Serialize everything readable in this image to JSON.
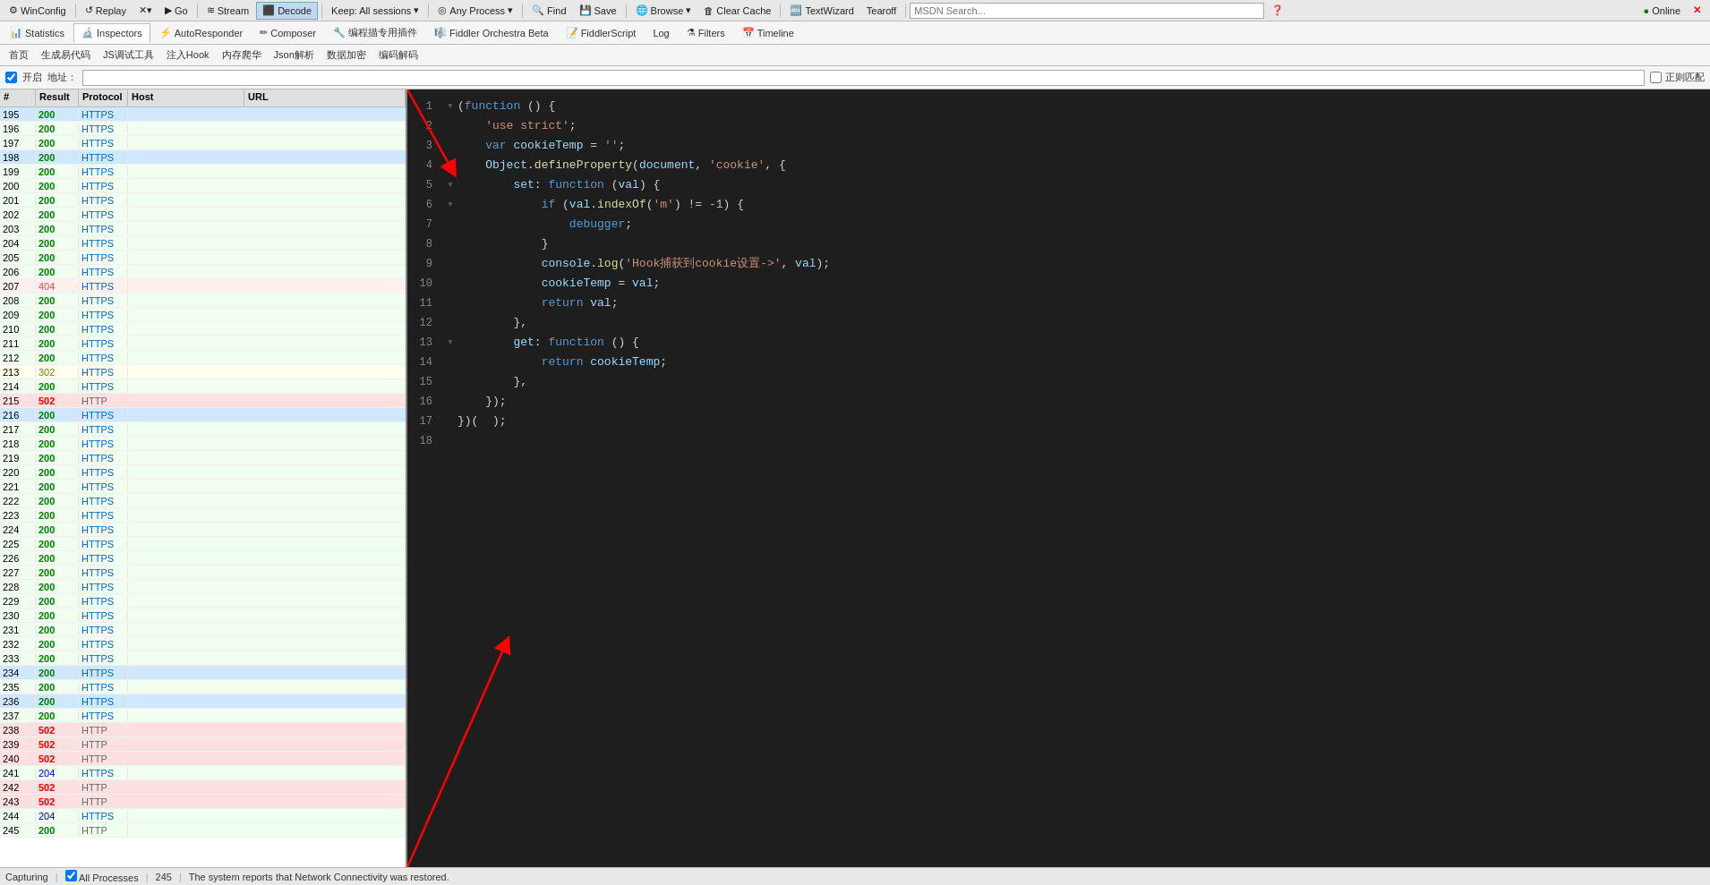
{
  "toolbar": {
    "winconfig_label": "WinConfig",
    "replay_label": "Replay",
    "go_label": "Go",
    "stream_label": "Stream",
    "decode_label": "Decode",
    "keep_label": "Keep: All sessions",
    "any_process_label": "Any Process",
    "find_label": "Find",
    "save_label": "Save",
    "browse_label": "Browse",
    "clear_cache_label": "Clear Cache",
    "textwizard_label": "TextWizard",
    "tearoff_label": "Tearoff",
    "msdn_placeholder": "MSDN Search...",
    "online_label": "Online"
  },
  "tabs": {
    "statistics_label": "Statistics",
    "inspectors_label": "Inspectors",
    "autoresponder_label": "AutoResponder",
    "composer_label": "Composer",
    "editor_label": "编程描专用插件",
    "fiddler_orchestra_label": "Fiddler Orchestra Beta",
    "fiddler_script_label": "FiddlerScript",
    "log_label": "Log",
    "filters_label": "Filters",
    "timeline_label": "Timeline"
  },
  "chinese_toolbar": {
    "home_label": "首页",
    "gen_code_label": "生成易代码",
    "js_debug_label": "JS调试工具",
    "hook_label": "注入Hook",
    "memory_label": "内存爬华",
    "json_parse_label": "Json解析",
    "data_decrypt_label": "数据加密",
    "decode_label": "编码解码"
  },
  "filter_bar": {
    "enable_label": "开启",
    "address_label": "地址：",
    "regex_label": "正则匹配"
  },
  "session_columns": {
    "num": "#",
    "result": "Result",
    "protocol": "Protocol",
    "host": "Host",
    "url": "URL"
  },
  "sessions": [
    {
      "num": "195",
      "result": "200",
      "protocol": "HTTPS",
      "host": "",
      "url": "",
      "style": "status-200 highlight-blue"
    },
    {
      "num": "196",
      "result": "200",
      "protocol": "HTTPS",
      "host": "",
      "url": "",
      "style": "status-200"
    },
    {
      "num": "197",
      "result": "200",
      "protocol": "HTTPS",
      "host": "",
      "url": "",
      "style": "status-200"
    },
    {
      "num": "198",
      "result": "200",
      "protocol": "HTTPS",
      "host": "",
      "url": "",
      "style": "status-200 highlight-blue"
    },
    {
      "num": "199",
      "result": "200",
      "protocol": "HTTPS",
      "host": "",
      "url": "",
      "style": "status-200"
    },
    {
      "num": "200",
      "result": "200",
      "protocol": "HTTPS",
      "host": "",
      "url": "",
      "style": "status-200"
    },
    {
      "num": "201",
      "result": "200",
      "protocol": "HTTPS",
      "host": "",
      "url": "",
      "style": "status-200"
    },
    {
      "num": "202",
      "result": "200",
      "protocol": "HTTPS",
      "host": "",
      "url": "",
      "style": "status-200"
    },
    {
      "num": "203",
      "result": "200",
      "protocol": "HTTPS",
      "host": "",
      "url": "",
      "style": "status-200"
    },
    {
      "num": "204",
      "result": "200",
      "protocol": "HTTPS",
      "host": "",
      "url": "",
      "style": "status-200"
    },
    {
      "num": "205",
      "result": "200",
      "protocol": "HTTPS",
      "host": "",
      "url": "",
      "style": "status-200"
    },
    {
      "num": "206",
      "result": "200",
      "protocol": "HTTPS",
      "host": "",
      "url": "",
      "style": "status-200"
    },
    {
      "num": "207",
      "result": "404",
      "protocol": "HTTPS",
      "host": "",
      "url": "",
      "style": "status-404"
    },
    {
      "num": "208",
      "result": "200",
      "protocol": "HTTPS",
      "host": "",
      "url": "",
      "style": "status-200"
    },
    {
      "num": "209",
      "result": "200",
      "protocol": "HTTPS",
      "host": "",
      "url": "",
      "style": "status-200"
    },
    {
      "num": "210",
      "result": "200",
      "protocol": "HTTPS",
      "host": "",
      "url": "",
      "style": "status-200"
    },
    {
      "num": "211",
      "result": "200",
      "protocol": "HTTPS",
      "host": "",
      "url": "",
      "style": "status-200"
    },
    {
      "num": "212",
      "result": "200",
      "protocol": "HTTPS",
      "host": "",
      "url": "",
      "style": "status-200"
    },
    {
      "num": "213",
      "result": "302",
      "protocol": "HTTPS",
      "host": "",
      "url": "",
      "style": "status-302"
    },
    {
      "num": "214",
      "result": "200",
      "protocol": "HTTPS",
      "host": "",
      "url": "",
      "style": "status-200"
    },
    {
      "num": "215",
      "result": "502",
      "protocol": "HTTP",
      "host": "",
      "url": "",
      "style": "status-502"
    },
    {
      "num": "216",
      "result": "200",
      "protocol": "HTTPS",
      "host": "",
      "url": "",
      "style": "status-200 highlight-blue"
    },
    {
      "num": "217",
      "result": "200",
      "protocol": "HTTPS",
      "host": "",
      "url": "",
      "style": "status-200"
    },
    {
      "num": "218",
      "result": "200",
      "protocol": "HTTPS",
      "host": "",
      "url": "",
      "style": "status-200"
    },
    {
      "num": "219",
      "result": "200",
      "protocol": "HTTPS",
      "host": "",
      "url": "",
      "style": "status-200"
    },
    {
      "num": "220",
      "result": "200",
      "protocol": "HTTPS",
      "host": "",
      "url": "",
      "style": "status-200"
    },
    {
      "num": "221",
      "result": "200",
      "protocol": "HTTPS",
      "host": "",
      "url": "",
      "style": "status-200"
    },
    {
      "num": "222",
      "result": "200",
      "protocol": "HTTPS",
      "host": "",
      "url": "",
      "style": "status-200"
    },
    {
      "num": "223",
      "result": "200",
      "protocol": "HTTPS",
      "host": "",
      "url": "",
      "style": "status-200"
    },
    {
      "num": "224",
      "result": "200",
      "protocol": "HTTPS",
      "host": "",
      "url": "",
      "style": "status-200"
    },
    {
      "num": "225",
      "result": "200",
      "protocol": "HTTPS",
      "host": "",
      "url": "",
      "style": "status-200"
    },
    {
      "num": "226",
      "result": "200",
      "protocol": "HTTPS",
      "host": "",
      "url": "",
      "style": "status-200"
    },
    {
      "num": "227",
      "result": "200",
      "protocol": "HTTPS",
      "host": "",
      "url": "",
      "style": "status-200"
    },
    {
      "num": "228",
      "result": "200",
      "protocol": "HTTPS",
      "host": "",
      "url": "",
      "style": "status-200"
    },
    {
      "num": "229",
      "result": "200",
      "protocol": "HTTPS",
      "host": "",
      "url": "",
      "style": "status-200"
    },
    {
      "num": "230",
      "result": "200",
      "protocol": "HTTPS",
      "host": "",
      "url": "",
      "style": "status-200"
    },
    {
      "num": "231",
      "result": "200",
      "protocol": "HTTPS",
      "host": "",
      "url": "",
      "style": "status-200"
    },
    {
      "num": "232",
      "result": "200",
      "protocol": "HTTPS",
      "host": "",
      "url": "",
      "style": "status-200"
    },
    {
      "num": "233",
      "result": "200",
      "protocol": "HTTPS",
      "host": "",
      "url": "",
      "style": "status-200"
    },
    {
      "num": "234",
      "result": "200",
      "protocol": "HTTPS",
      "host": "",
      "url": "",
      "style": "status-200 highlight-blue"
    },
    {
      "num": "235",
      "result": "200",
      "protocol": "HTTPS",
      "host": "",
      "url": "",
      "style": "status-200"
    },
    {
      "num": "236",
      "result": "200",
      "protocol": "HTTPS",
      "host": "",
      "url": "",
      "style": "status-200 highlight-blue"
    },
    {
      "num": "237",
      "result": "200",
      "protocol": "HTTPS",
      "host": "",
      "url": "",
      "style": "status-200"
    },
    {
      "num": "238",
      "result": "502",
      "protocol": "HTTP",
      "host": "",
      "url": "",
      "style": "status-502"
    },
    {
      "num": "239",
      "result": "502",
      "protocol": "HTTP",
      "host": "",
      "url": "",
      "style": "status-502"
    },
    {
      "num": "240",
      "result": "502",
      "protocol": "HTTP",
      "host": "",
      "url": "",
      "style": "status-502"
    },
    {
      "num": "241",
      "result": "204",
      "protocol": "HTTPS",
      "host": "",
      "url": "",
      "style": "status-200"
    },
    {
      "num": "242",
      "result": "502",
      "protocol": "HTTP",
      "host": "",
      "url": "",
      "style": "status-502"
    },
    {
      "num": "243",
      "result": "502",
      "protocol": "HTTP",
      "host": "",
      "url": "",
      "style": "status-502"
    },
    {
      "num": "244",
      "result": "204",
      "protocol": "HTTPS",
      "host": "",
      "url": "",
      "style": "status-200"
    },
    {
      "num": "245",
      "result": "200",
      "protocol": "HTTP",
      "host": "",
      "url": "",
      "style": "status-200"
    }
  ],
  "code": {
    "lines": [
      {
        "num": 1,
        "indent": 0,
        "has_collapse": true,
        "content": "(function () {"
      },
      {
        "num": 2,
        "indent": 1,
        "has_collapse": false,
        "content": "    'use strict';"
      },
      {
        "num": 3,
        "indent": 1,
        "has_collapse": false,
        "content": "    var cookieTemp = '';"
      },
      {
        "num": 4,
        "indent": 1,
        "has_collapse": true,
        "content": "    Object.defineProperty(document, 'cookie', {"
      },
      {
        "num": 5,
        "indent": 2,
        "has_collapse": true,
        "content": "        set: function (val) {"
      },
      {
        "num": 6,
        "indent": 3,
        "has_collapse": true,
        "content": "            if (val.indexOf('m') != -1) {"
      },
      {
        "num": 7,
        "indent": 4,
        "has_collapse": false,
        "content": "                debugger;"
      },
      {
        "num": 8,
        "indent": 3,
        "has_collapse": false,
        "content": "            }"
      },
      {
        "num": 9,
        "indent": 3,
        "has_collapse": false,
        "content": "            console.log('Hook捕获到cookie设置->', val);"
      },
      {
        "num": 10,
        "indent": 3,
        "has_collapse": false,
        "content": "            cookieTemp = val;"
      },
      {
        "num": 11,
        "indent": 3,
        "has_collapse": false,
        "content": "            return val;"
      },
      {
        "num": 12,
        "indent": 2,
        "has_collapse": false,
        "content": "        },"
      },
      {
        "num": 13,
        "indent": 2,
        "has_collapse": true,
        "content": "        get: function () {"
      },
      {
        "num": 14,
        "indent": 3,
        "has_collapse": false,
        "content": "            return cookieTemp;"
      },
      {
        "num": 15,
        "indent": 2,
        "has_collapse": false,
        "content": "        },"
      },
      {
        "num": 16,
        "indent": 1,
        "has_collapse": false,
        "content": "    });"
      },
      {
        "num": 17,
        "indent": 0,
        "has_collapse": false,
        "content": "})(  );"
      },
      {
        "num": 18,
        "indent": 0,
        "has_collapse": false,
        "content": ""
      }
    ]
  },
  "status_bar": {
    "capturing_label": "Capturing",
    "all_processes_label": "All Processes",
    "count": "245",
    "message": "The system reports that Network Connectivity was restored."
  }
}
